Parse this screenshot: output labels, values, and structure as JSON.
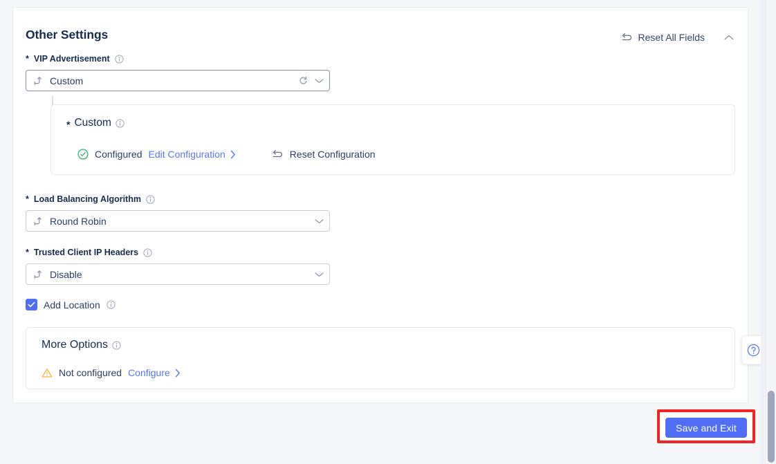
{
  "header": {
    "title": "Other Settings",
    "reset_all_label": "Reset All Fields",
    "reset_all_icon": "reset-arrow-icon",
    "collapse_icon": "chevron-up-icon"
  },
  "fields": {
    "vip_advertisement": {
      "label": "VIP Advertisement",
      "required_marker": "*",
      "info_icon": "info-icon",
      "value": "Custom",
      "prefix_icon": "route-arrow-icon",
      "refresh_icon": "refresh-icon",
      "chevron_icon": "chevron-down-icon"
    },
    "load_balancing": {
      "label": "Load Balancing Algorithm",
      "required_marker": "*",
      "info_icon": "info-icon",
      "value": "Round Robin",
      "prefix_icon": "route-arrow-icon",
      "chevron_icon": "chevron-down-icon"
    },
    "trusted_client_ip": {
      "label": "Trusted Client IP Headers",
      "required_marker": "*",
      "info_icon": "info-icon",
      "value": "Disable",
      "prefix_icon": "route-arrow-icon",
      "chevron_icon": "chevron-down-icon"
    },
    "add_location": {
      "label": "Add Location",
      "checked": true,
      "info_icon": "info-icon",
      "check_icon": "checkmark-icon"
    }
  },
  "custom_panel": {
    "required_marker": "*",
    "title": "Custom",
    "info_icon": "info-icon",
    "status_icon": "check-circle-icon",
    "status_text": "Configured",
    "edit_link": "Edit Configuration",
    "edit_chevron": "chevron-right-icon",
    "reset_label": "Reset Configuration",
    "reset_icon": "reset-arrow-icon"
  },
  "more_options_panel": {
    "title": "More Options",
    "info_icon": "info-icon",
    "status_icon": "warning-triangle-icon",
    "status_text": "Not configured",
    "configure_link": "Configure",
    "configure_chevron": "chevron-right-icon"
  },
  "footer": {
    "save_label": "Save and Exit"
  },
  "help": {
    "icon": "question-circle-icon",
    "label": "?"
  },
  "colors": {
    "accent_blue": "#4f6df5",
    "link_blue": "#5b76f7",
    "title_navy": "#172b4d",
    "success_green": "#36b37e",
    "warning_amber": "#f5b544",
    "highlight_red": "#f42222",
    "page_bg": "#f5f6f8"
  }
}
